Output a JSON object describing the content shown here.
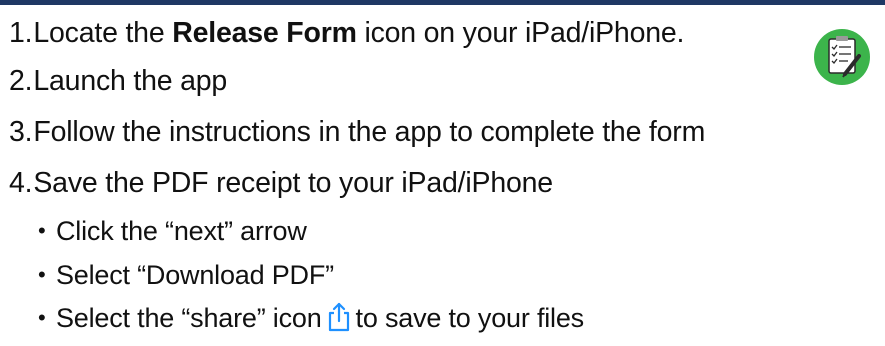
{
  "steps": [
    {
      "num": "1.",
      "pre": "Locate the ",
      "bold": "Release Form",
      "post": " icon on your iPad/iPhone."
    },
    {
      "num": "2.",
      "text": "Launch the app"
    },
    {
      "num": "3.",
      "text": "Follow the instructions in the app to complete the form"
    },
    {
      "num": "4.",
      "text": "Save the PDF receipt to your iPad/iPhone"
    }
  ],
  "substeps": [
    {
      "text": "Click the “next” arrow"
    },
    {
      "text": "Select “Download PDF”"
    },
    {
      "pre": "Select the “share” icon",
      "post": "to save to your files"
    }
  ],
  "bullet_char": "•",
  "icons": {
    "app": "release-form-app-icon",
    "share": "share-icon"
  },
  "colors": {
    "top_bar": "#1f3864",
    "app_icon_green": "#3cb44b",
    "share_icon_blue": "#1e90ff"
  }
}
